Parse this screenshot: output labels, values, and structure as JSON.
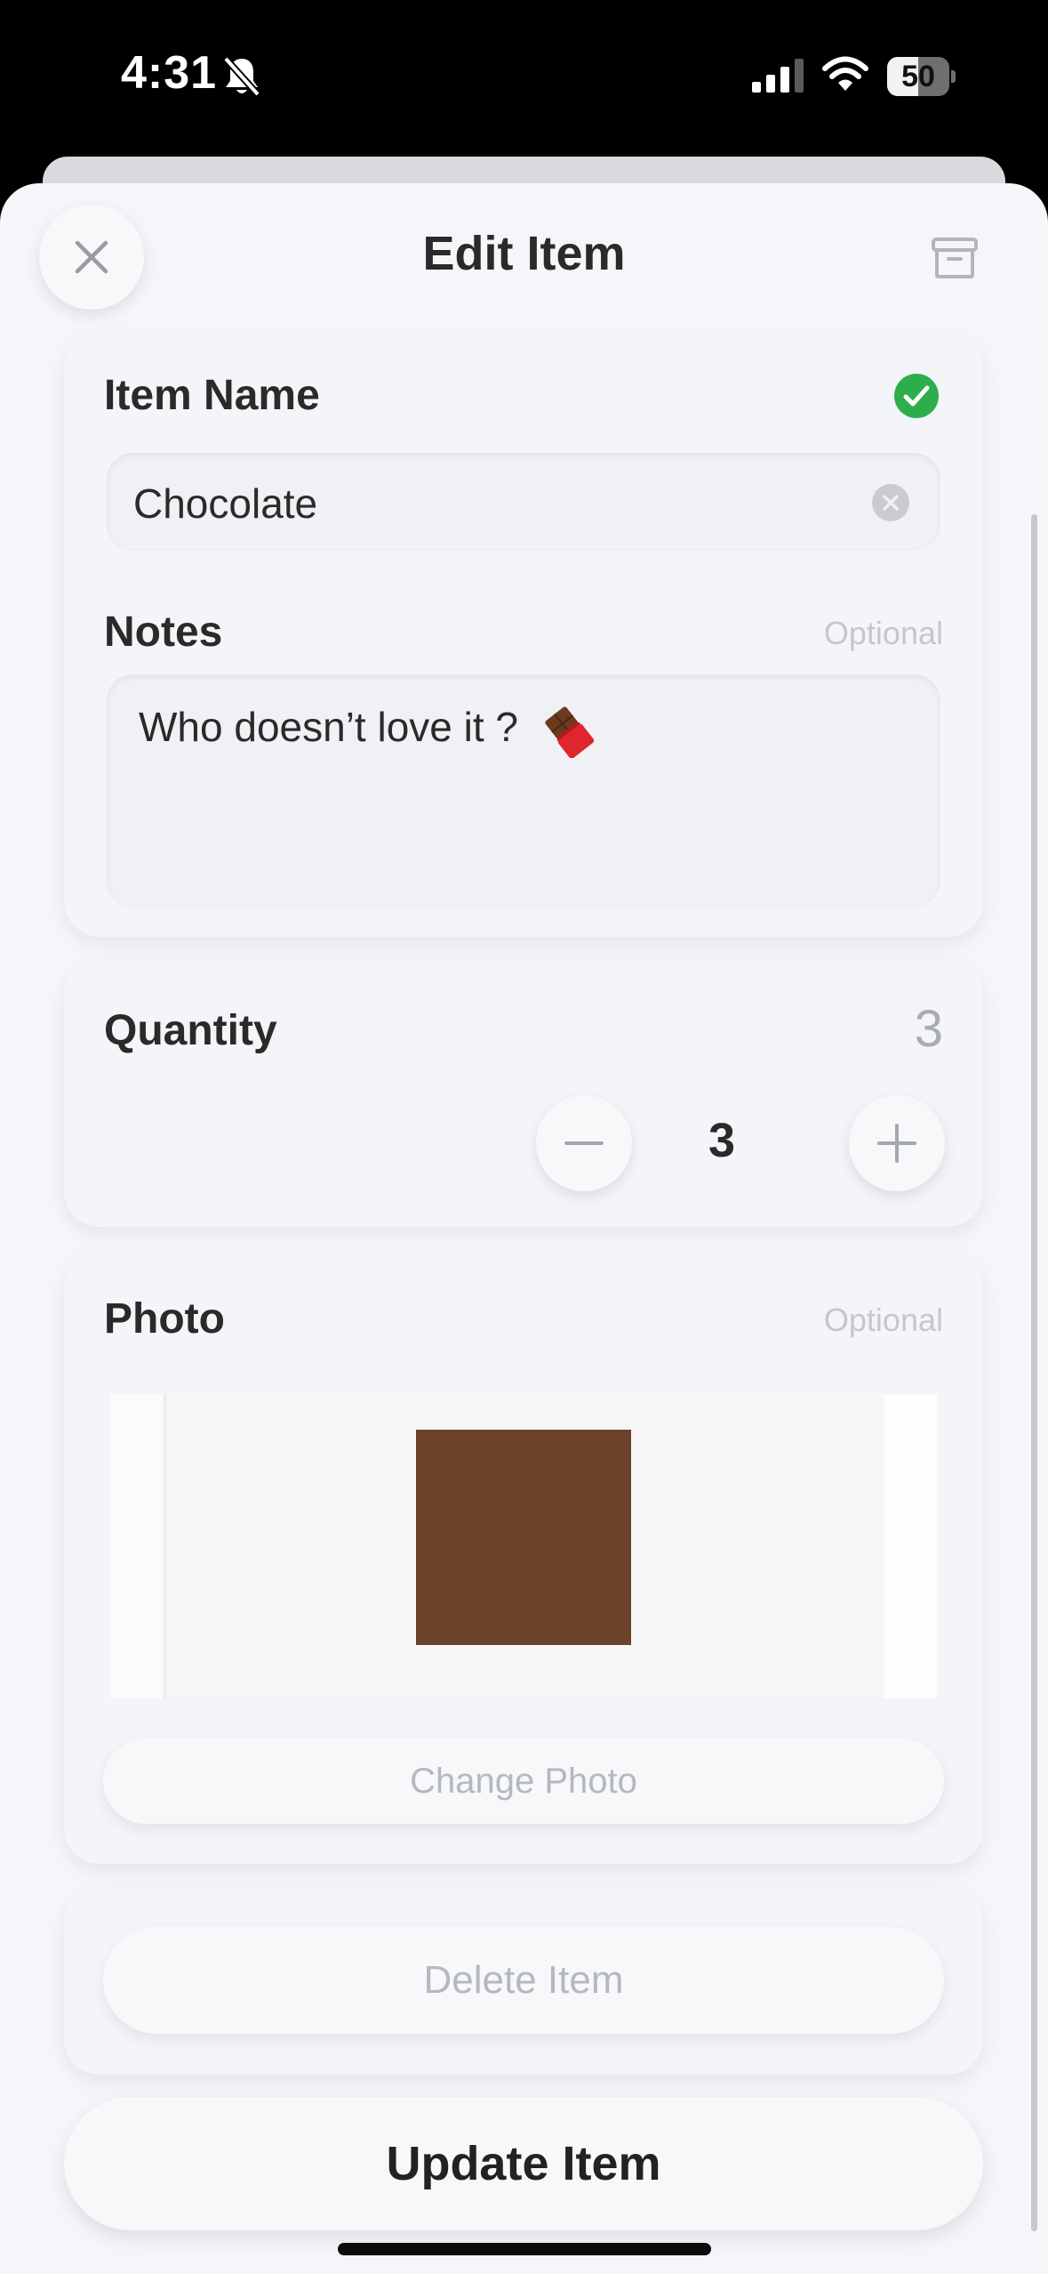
{
  "status_bar": {
    "time": "4:31",
    "battery_level": "50",
    "battery_fraction": 0.5,
    "icons": [
      "bell-slash-icon",
      "signal-icon",
      "wifi-icon",
      "battery-icon"
    ]
  },
  "header": {
    "title": "Edit Item",
    "close_icon": "close-icon",
    "archive_icon": "archive-icon"
  },
  "item_name": {
    "label": "Item Name",
    "value": "Chocolate",
    "status_icon": "check-circle-icon",
    "status_color": "#2dae4c",
    "clear_icon": "clear-circle-icon"
  },
  "notes": {
    "label": "Notes",
    "optional_label": "Optional",
    "value": "Who doesn’t love it ?",
    "emoji_icon": "chocolate-bar-icon"
  },
  "quantity": {
    "label": "Quantity",
    "display_value": "3",
    "value": "3",
    "minus_icon": "minus-icon",
    "plus_icon": "plus-icon"
  },
  "photo": {
    "label": "Photo",
    "optional_label": "Optional",
    "image_color": "#6b4129",
    "change_button": "Change Photo"
  },
  "actions": {
    "delete_button": "Delete Item",
    "update_button": "Update Item"
  }
}
